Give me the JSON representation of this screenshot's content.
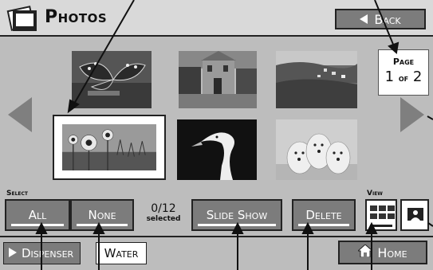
{
  "header": {
    "title": "Photos",
    "back_label": "Back"
  },
  "pagination": {
    "label": "Page",
    "current": "1",
    "of_label": "of",
    "total": "2"
  },
  "selection": {
    "section_label": "Select",
    "all_label": "All",
    "none_label": "None",
    "count": "0/12",
    "count_suffix": "selected"
  },
  "actions": {
    "slideshow_label": "Slide Show",
    "delete_label": "Delete"
  },
  "view": {
    "section_label": "View"
  },
  "footer": {
    "dispenser_label": "Dispenser",
    "water_label": "Water",
    "home_label": "Home"
  },
  "thumbnails": [
    {
      "name": "butterfly",
      "selected": false
    },
    {
      "name": "village-street",
      "selected": false
    },
    {
      "name": "coastal-town",
      "selected": false
    },
    {
      "name": "sunflowers",
      "selected": true
    },
    {
      "name": "swan",
      "selected": false
    },
    {
      "name": "puppies",
      "selected": false
    }
  ],
  "colors": {
    "background": "#bdbdbd",
    "button": "#7c7c7c",
    "header": "#d9d9d9"
  }
}
